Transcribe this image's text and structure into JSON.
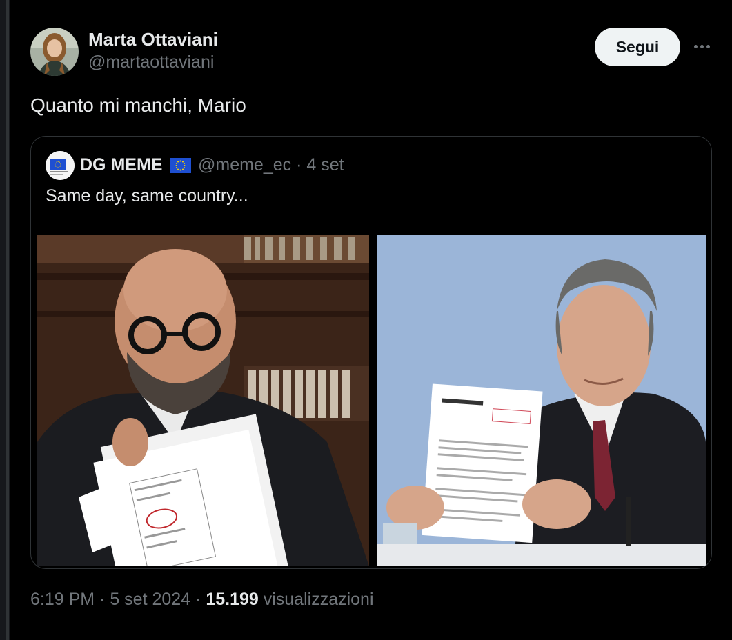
{
  "author": {
    "name": "Marta Ottaviani",
    "handle": "@martaottaviani",
    "follow_label": "Segui"
  },
  "tweet": {
    "text": "Quanto mi manchi, Mario"
  },
  "quoted": {
    "name": "DG MEME",
    "handle": "@meme_ec",
    "separator": " · ",
    "date": "4 set",
    "text": "Same day, same country..."
  },
  "footer": {
    "time": "6:19 PM",
    "sep1": " · ",
    "date": "5 set 2024",
    "sep2": " · ",
    "views_count": "15.199",
    "views_label": " visualizzazioni"
  },
  "colors": {
    "background": "#000000",
    "text": "#e7e9ea",
    "secondary": "#71767b",
    "border": "#2f3336",
    "follow_bg": "#eff3f4"
  },
  "icons": [
    "more-icon",
    "eu-flag-icon"
  ]
}
